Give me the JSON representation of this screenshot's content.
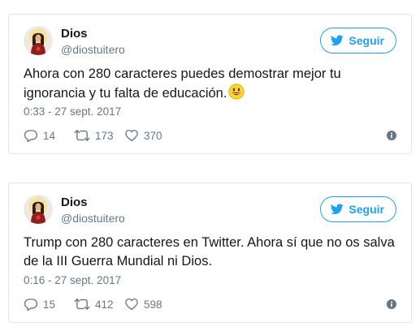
{
  "tweets": [
    {
      "display_name": "Dios",
      "handle": "@diostuitero",
      "follow_label": "Seguir",
      "text": "Ahora con 280 caracteres puedes demostrar mejor tu ignorancia y tu falta de educación.",
      "emoji": "smiling-face-emoji",
      "timestamp": "0:33 - 27 sept. 2017",
      "replies": "14",
      "retweets": "173",
      "likes": "370"
    },
    {
      "display_name": "Dios",
      "handle": "@diostuitero",
      "follow_label": "Seguir",
      "text": "Trump con 280 caracteres en Twitter. Ahora sí que no os salva de la III Guerra Mundial ni Dios.",
      "timestamp": "0:16 - 27 sept. 2017",
      "replies": "15",
      "retweets": "412",
      "likes": "598"
    }
  ],
  "colors": {
    "accent": "#1da1f2",
    "muted_text": "#657786",
    "border": "#e1e8ed",
    "text": "#14171a"
  },
  "icons": [
    "avatar-jesus-image",
    "twitter-bird-icon",
    "reply-icon",
    "retweet-icon",
    "like-icon",
    "info-icon"
  ]
}
